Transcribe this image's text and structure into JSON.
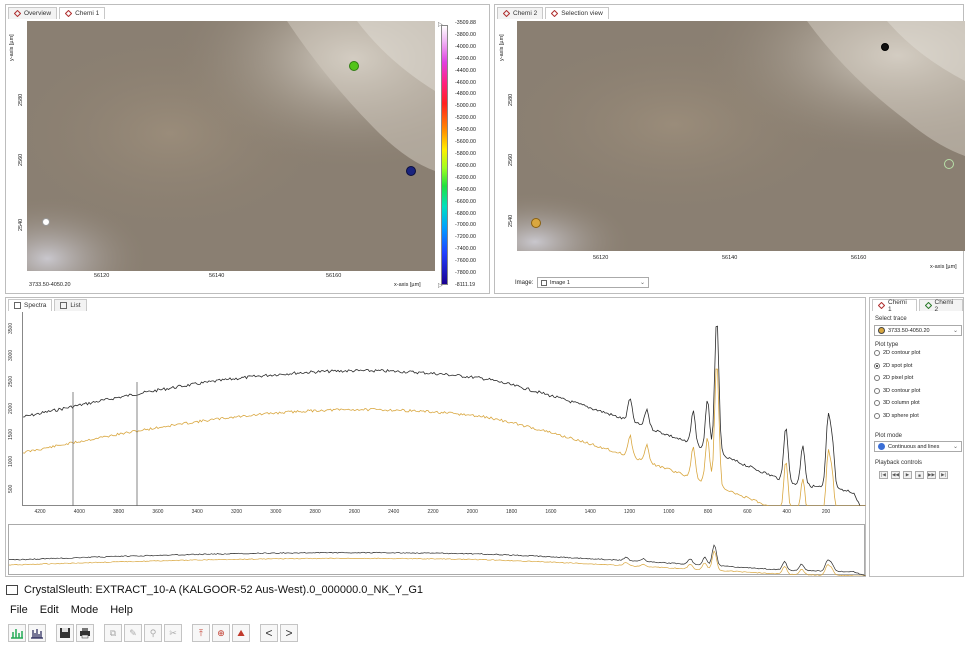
{
  "left_view": {
    "tabs": [
      {
        "label": "Overview"
      },
      {
        "label": "Chemi 1"
      }
    ],
    "y_axis_label": "y-axis [µm]",
    "x_axis_label": "x-axis [µm]",
    "coord_readout": "3733.50-4050.20",
    "y_ticks": [
      "2540",
      "2560",
      "2580"
    ],
    "x_ticks": [
      "56120",
      "56140",
      "56160"
    ],
    "colorbar_ticks": [
      "-3509.88",
      "-3800.00",
      "-4000.00",
      "-4200.00",
      "-4400.00",
      "-4600.00",
      "-4800.00",
      "-5000.00",
      "-5200.00",
      "-5400.00",
      "-5600.00",
      "-5800.00",
      "-6000.00",
      "-6200.00",
      "-6400.00",
      "-6600.00",
      "-6800.00",
      "-7000.00",
      "-7200.00",
      "-7400.00",
      "-7600.00",
      "-7800.00",
      "-8111.19"
    ]
  },
  "right_view": {
    "tabs": [
      {
        "label": "Chemi 2"
      },
      {
        "label": "Selection view"
      }
    ],
    "y_axis_label": "y-axis [µm]",
    "x_axis_label": "x-axis [µm]",
    "y_ticks": [
      "2540",
      "2560",
      "2580"
    ],
    "x_ticks": [
      "56120",
      "56140",
      "56160"
    ],
    "image_label": "Image:",
    "image_value": "Image 1"
  },
  "spectra_panel": {
    "tabs": [
      {
        "label": "Spectra"
      },
      {
        "label": "List"
      }
    ],
    "y_ticks": [
      "3500",
      "3000",
      "2500",
      "2000",
      "1500",
      "1000",
      "500"
    ],
    "x_ticks": [
      "4200",
      "4000",
      "3800",
      "3600",
      "3400",
      "3200",
      "3000",
      "2800",
      "2600",
      "2400",
      "2200",
      "2000",
      "1800",
      "1600",
      "1400",
      "1200",
      "1000",
      "800",
      "600",
      "400",
      "200"
    ]
  },
  "side_panel": {
    "tabs": [
      {
        "label": "Chemi 1"
      },
      {
        "label": "Chemi 2"
      }
    ],
    "select_trace_label": "Select trace",
    "trace_value": "3733.50-4050.20",
    "plot_type_label": "Plot type",
    "plot_types": [
      {
        "label": "2D contour plot",
        "selected": false
      },
      {
        "label": "2D spot plot",
        "selected": true
      },
      {
        "label": "2D pixel plot",
        "selected": false
      },
      {
        "label": "3D contour plot",
        "selected": false
      },
      {
        "label": "3D column plot",
        "selected": false
      },
      {
        "label": "3D sphere plot",
        "selected": false
      }
    ],
    "plot_mode_label": "Plot mode",
    "plot_mode_value": "Continuous and lines",
    "playback_label": "Playback controls"
  },
  "window": {
    "title": "CrystalSleuth: EXTRACT_10-A (KALGOOR-52 Aus-West).0_000000.0_NK_Y_G1"
  },
  "menu": [
    "File",
    "Edit",
    "Mode",
    "Help"
  ],
  "colors": {
    "spectrum_dark": "#2a2a2a",
    "spectrum_gold": "#d9a740",
    "accent_red": "#c0392b"
  }
}
